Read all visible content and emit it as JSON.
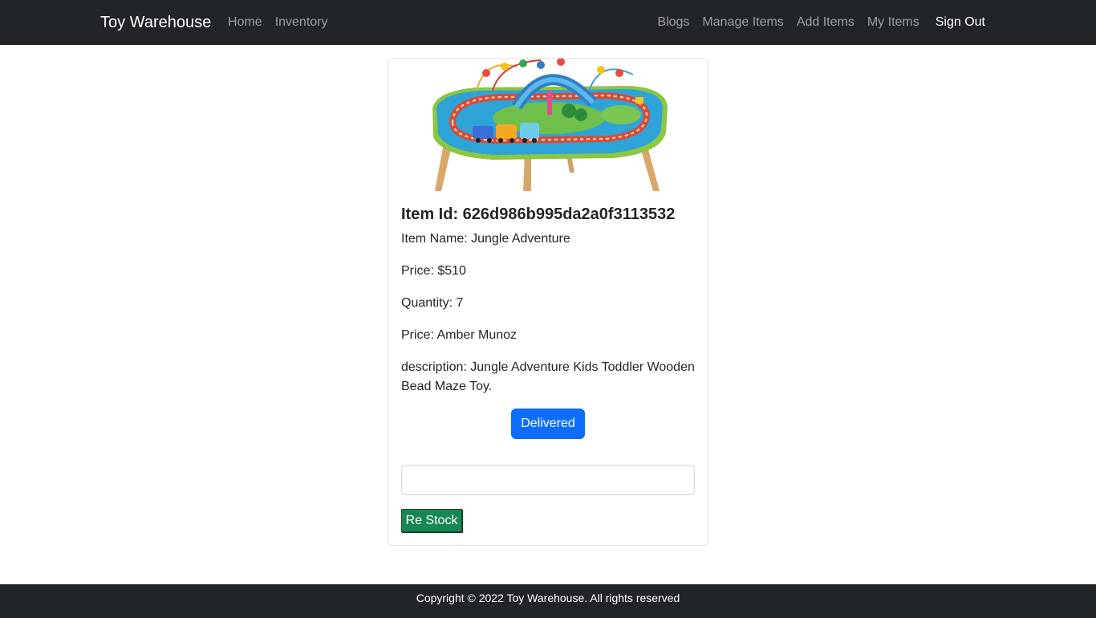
{
  "navbar": {
    "brand": "Toy Warehouse",
    "left_links": [
      "Home",
      "Inventory"
    ],
    "right_links": [
      "Blogs",
      "Manage Items",
      "Add Items",
      "My Items"
    ],
    "sign_out": "Sign Out",
    "background": "#212529"
  },
  "item": {
    "image_alt": "Jungle Adventure wooden bead maze toy table",
    "id_line": "Item Id: 626d986b995da2a0f3113532",
    "name_line": "Item Name: Jungle Adventure",
    "price_line": "Price: $510",
    "quantity_line": "Quantity: 7",
    "supplier_line": "Price: Amber Munoz",
    "description_line": "description: Jungle Adventure Kids Toddler Wooden Bead Maze Toy.",
    "delivered_label": "Delivered",
    "restock_input_value": "",
    "restock_label": "Re Stock"
  },
  "colors": {
    "primary": "#0d6efd",
    "success": "#198754",
    "dark": "#212529"
  },
  "footer": {
    "copyright": "Copyright © 2022 Toy Warehouse. All rights reserved"
  }
}
